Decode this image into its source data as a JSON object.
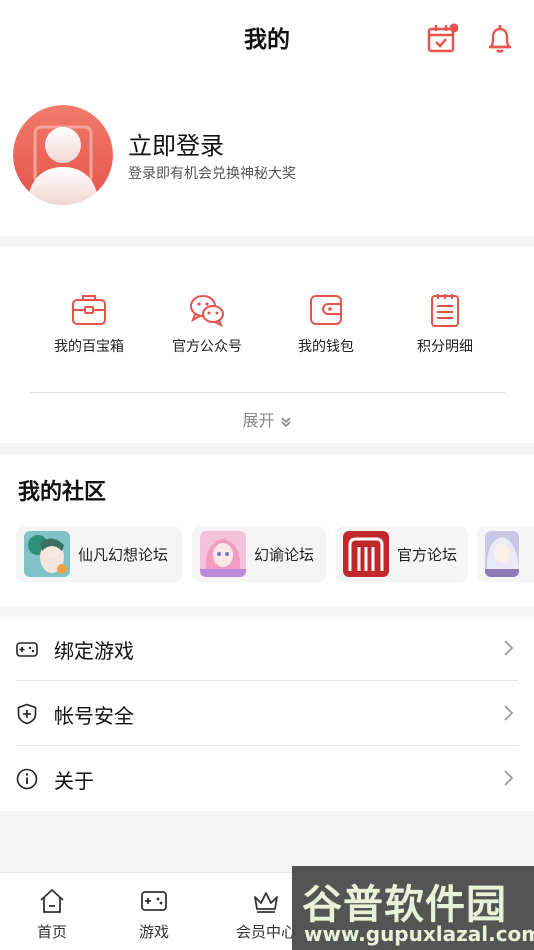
{
  "header": {
    "title": "我的"
  },
  "profile": {
    "login_title": "立即登录",
    "login_subtitle": "登录即有机会兑换神秘大奖"
  },
  "tools": {
    "items": [
      {
        "label": "我的百宝箱",
        "icon": "toolbox-icon"
      },
      {
        "label": "官方公众号",
        "icon": "wechat-icon"
      },
      {
        "label": "我的钱包",
        "icon": "wallet-icon"
      },
      {
        "label": "积分明细",
        "icon": "clipboard-icon"
      }
    ],
    "expand_label": "展开"
  },
  "community": {
    "title": "我的社区",
    "forums": [
      {
        "name": "仙凡幻想论坛"
      },
      {
        "name": "幻谕论坛"
      },
      {
        "name": "官方论坛"
      }
    ]
  },
  "menu": {
    "items": [
      {
        "label": "绑定游戏",
        "icon": "gamepad-icon"
      },
      {
        "label": "帐号安全",
        "icon": "shield-icon"
      },
      {
        "label": "关于",
        "icon": "info-icon"
      }
    ]
  },
  "tabbar": {
    "items": [
      {
        "label": "首页",
        "icon": "home-icon"
      },
      {
        "label": "游戏",
        "icon": "game-icon"
      },
      {
        "label": "会员中心",
        "icon": "crown-icon"
      }
    ]
  },
  "watermark": {
    "title": "谷普软件园",
    "url": "www.gupuxlazal.com"
  },
  "colors": {
    "accent": "#e8534b",
    "background": "#f5f5f5"
  }
}
